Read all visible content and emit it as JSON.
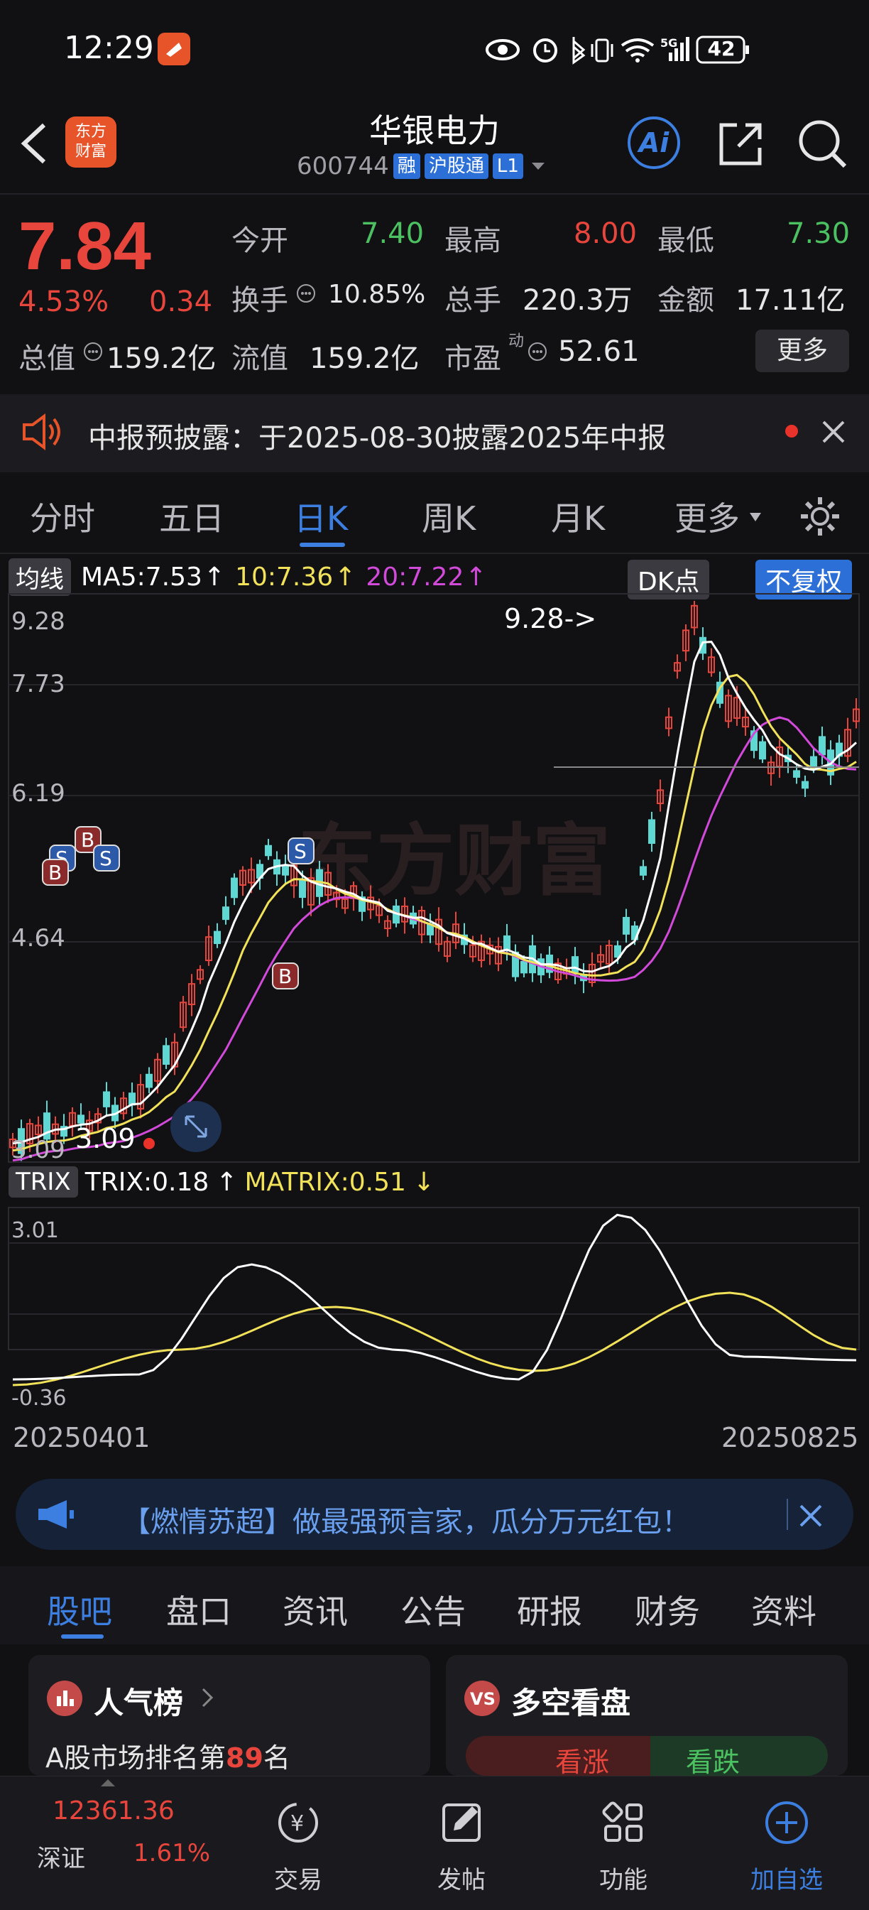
{
  "status": {
    "time": "12:29",
    "battery": "42"
  },
  "header": {
    "logo_line1": "东方",
    "logo_line2": "财富",
    "stock_name": "华银电力",
    "stock_code": "600744",
    "tags": [
      "融",
      "沪股通",
      "L1"
    ],
    "ai_label": "Ai"
  },
  "quote": {
    "price": "7.84",
    "change_pct": "4.53%",
    "change_amt": "0.34",
    "open_label": "今开",
    "open": "7.40",
    "high_label": "最高",
    "high": "8.00",
    "low_label": "最低",
    "low": "7.30",
    "turnover_label": "换手",
    "turnover": "10.85%",
    "volume_label": "总手",
    "volume": "220.3万",
    "amount_label": "金额",
    "amount": "17.11亿",
    "mktcap_label": "总值",
    "mktcap": "159.2亿",
    "float_label": "流值",
    "float": "159.2亿",
    "pe_label": "市盈",
    "pe_sup": "动",
    "pe": "52.61",
    "more": "更多"
  },
  "notice": {
    "text": "中报预披露：于2025-08-30披露2025年中报"
  },
  "kline_tabs": [
    "分时",
    "五日",
    "日K",
    "周K",
    "月K",
    "更多"
  ],
  "active_tab": "日K",
  "ma_row": {
    "selector": "均线",
    "ma5": "MA5:7.53",
    "ma10": "10:7.36",
    "ma20": "20:7.22",
    "dk": "DK点",
    "fuquan": "不复权"
  },
  "price_axis": [
    "9.28",
    "7.73",
    "6.19",
    "4.64",
    "3.09"
  ],
  "annotations": {
    "high": "9.28->",
    "low": "3.09",
    "buy": "B",
    "sell": "S"
  },
  "watermark": "东方财富",
  "trix_row": {
    "selector": "TRIX",
    "trix": "TRIX:0.18",
    "matrix": "MATRIX:0.51"
  },
  "trix_axis": [
    "3.01",
    "-0.36"
  ],
  "date_axis": {
    "start": "20250401",
    "end": "20250825"
  },
  "banner": {
    "text": "【燃情苏超】做最强预言家，瓜分万元红包！"
  },
  "community_tabs": [
    "股吧",
    "盘口",
    "资讯",
    "公告",
    "研报",
    "财务",
    "资料"
  ],
  "cards": {
    "left_title": "人气榜",
    "left_sub_prefix": "A股市场排名第",
    "left_rank": "89",
    "left_sub_suffix": "名",
    "right_title": "多空看盘",
    "bull": "看涨",
    "bear": "看跌"
  },
  "bottom_nav": {
    "index_value": "12361.36",
    "index_name": "深证",
    "index_pct": "1.61%",
    "items": [
      "交易",
      "发帖",
      "功能",
      "加自选"
    ]
  },
  "colors": {
    "up": "#e8453c",
    "down": "#5fd7d3",
    "ma5": "#ffffff",
    "ma10": "#f2e25a",
    "ma20": "#d24ad9",
    "accent": "#3d7fe0"
  }
}
